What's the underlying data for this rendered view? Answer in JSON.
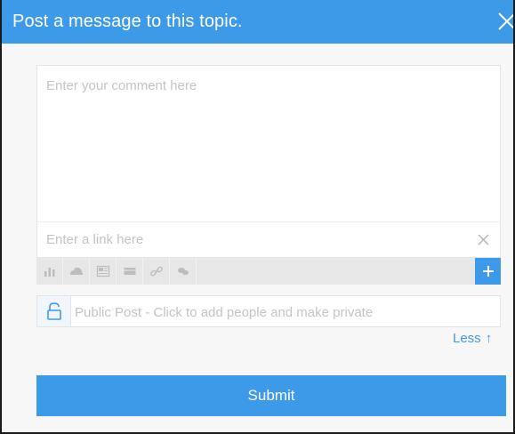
{
  "header": {
    "title": "Post a message to this topic.",
    "close_icon": "close-icon"
  },
  "comment": {
    "placeholder": "Enter your comment here",
    "value": ""
  },
  "link": {
    "placeholder": "Enter a link here",
    "value": "",
    "clear_icon": "close-icon"
  },
  "toolbar": {
    "tools": [
      {
        "name": "bar-chart-icon"
      },
      {
        "name": "cloud-icon"
      },
      {
        "name": "image-icon"
      },
      {
        "name": "table-icon"
      },
      {
        "name": "link-icon"
      },
      {
        "name": "chat-icon"
      }
    ],
    "add_icon": "plus-icon"
  },
  "privacy": {
    "label": "Public Post - Click to add people and make private",
    "icon": "unlock-icon"
  },
  "less": {
    "label": "Less",
    "arrow": "↑"
  },
  "submit": {
    "label": "Submit"
  },
  "colors": {
    "accent": "#3d9ae8",
    "panel": "#f7f7f7",
    "toolbar": "#e7e7e7",
    "placeholder": "#c4c4c4"
  }
}
